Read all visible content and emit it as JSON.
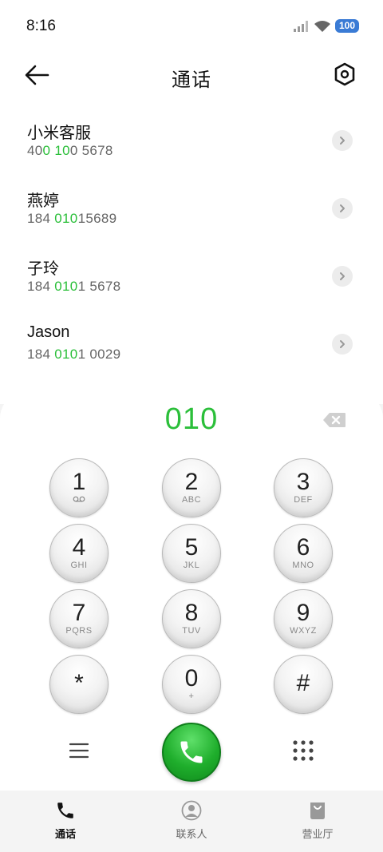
{
  "status_bar": {
    "time": "8:16",
    "battery": "100",
    "icons": [
      "signal-icon",
      "wifi-icon",
      "battery-icon"
    ]
  },
  "header": {
    "title": "通话",
    "back_icon": "arrow-left-icon",
    "settings_icon": "settings-hex-icon"
  },
  "contacts": [
    {
      "name": "小米客服",
      "number_parts": [
        {
          "t": "40",
          "h": false
        },
        {
          "t": "0",
          "h": true
        },
        {
          "t": " ",
          "h": false
        },
        {
          "t": "10",
          "h": true
        },
        {
          "t": "0 5678",
          "h": false
        }
      ]
    },
    {
      "name": "燕婷",
      "number_parts": [
        {
          "t": "184 ",
          "h": false
        },
        {
          "t": "010",
          "h": true
        },
        {
          "t": "15689",
          "h": false
        }
      ]
    },
    {
      "name": "子玲",
      "number_parts": [
        {
          "t": "184 ",
          "h": false
        },
        {
          "t": "010",
          "h": true
        },
        {
          "t": "1 5678",
          "h": false
        }
      ]
    },
    {
      "name": "Jason",
      "number_parts": [
        {
          "t": "184 ",
          "h": false
        },
        {
          "t": "010",
          "h": true
        },
        {
          "t": "1 0029",
          "h": false
        }
      ]
    }
  ],
  "dialer": {
    "dialed_number": "010",
    "keys": [
      {
        "digit": "1",
        "letters": ""
      },
      {
        "digit": "2",
        "letters": "ABC"
      },
      {
        "digit": "3",
        "letters": "DEF"
      },
      {
        "digit": "4",
        "letters": "GHI"
      },
      {
        "digit": "5",
        "letters": "JKL"
      },
      {
        "digit": "6",
        "letters": "MNO"
      },
      {
        "digit": "7",
        "letters": "PQRS"
      },
      {
        "digit": "8",
        "letters": "TUV"
      },
      {
        "digit": "9",
        "letters": "WXYZ"
      },
      {
        "digit": "*",
        "letters": ""
      },
      {
        "digit": "0",
        "letters": "+"
      },
      {
        "digit": "#",
        "letters": ""
      }
    ]
  },
  "bottom_nav": {
    "items": [
      {
        "label": "通话",
        "icon": "phone-icon",
        "active": true
      },
      {
        "label": "联系人",
        "icon": "person-icon",
        "active": false
      },
      {
        "label": "营业厅",
        "icon": "shopping-bag-icon",
        "active": false
      }
    ]
  },
  "colors": {
    "accent_green": "#2bbf3a",
    "battery_blue": "#3a7bd5"
  }
}
